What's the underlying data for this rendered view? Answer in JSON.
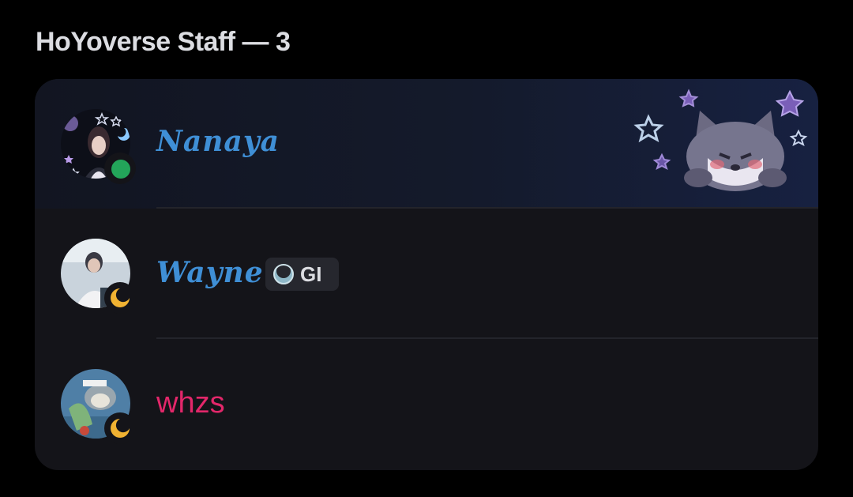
{
  "section": {
    "title": "HoYoverse Staff — 3"
  },
  "members": [
    {
      "name": "Nanaya",
      "status": "online",
      "tag": null
    },
    {
      "name": "Wayne",
      "status": "idle",
      "tag": {
        "label": "GI",
        "icon": "genshin-moon-icon"
      }
    },
    {
      "name": "whzs",
      "status": "idle",
      "tag": null
    }
  ],
  "colors": {
    "online": "#23a55a",
    "idle": "#f0b232",
    "name_gothic": "#3f8fd6",
    "name_pink": "#e3276a"
  }
}
